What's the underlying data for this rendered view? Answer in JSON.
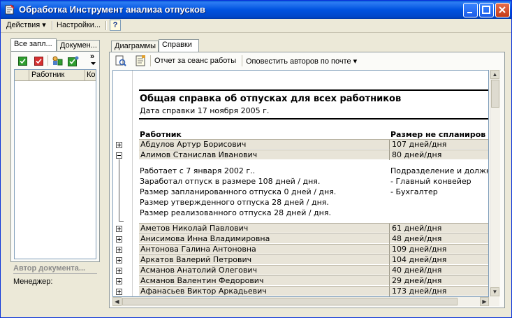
{
  "window": {
    "title": "Обработка  Инструмент анализа отпусков"
  },
  "menu": {
    "actions": "Действия ▾",
    "settings": "Настройки...",
    "help": "?"
  },
  "left": {
    "tabs": [
      "Все запл...",
      "Докумен..."
    ],
    "toolbar_more": "»",
    "list_header": {
      "col1": "Работник",
      "col2": "Ко"
    },
    "author_title": "Автор документа...",
    "manager_label": "Менеджер:"
  },
  "right": {
    "tabs": [
      "Диаграммы",
      "Справки"
    ],
    "toolbar": {
      "report_session": "Отчет за сеанс работы",
      "notify_authors": "Оповестить авторов по почте ▾"
    }
  },
  "report": {
    "title": "Общая справка об отпусках для всех работников",
    "date_line": "Дата справки 17 ноября 2005 г.",
    "col_employee": "Работник",
    "col_size": "Размер не спланиров",
    "rows_top": [
      {
        "name": "Абдулов Артур Борисович",
        "size": "107 дней/дня",
        "expanded": false
      },
      {
        "name": "Алимов Станислав Иванович",
        "size": "80 дней/дня",
        "expanded": true
      }
    ],
    "details_left": [
      "Работает с 7 января 2002 г..",
      "Заработал отпуск в размере 108 дней / дня.",
      "Размер запланированного отпуска 0 дней / дня.",
      "Размер утвержденного отпуска 28 дней / дня.",
      "Размер реализованного отпуска 28 дней / дня."
    ],
    "details_right": [
      "Подразделение и должн",
      "- Главный конвейер",
      "- Бухгалтер"
    ],
    "rows_bottom": [
      {
        "name": "Аметов Николай Павлович",
        "size": "61 дней/дня"
      },
      {
        "name": "Анисимова Инна Владимировна",
        "size": "48 дней/дня"
      },
      {
        "name": "Антонова Галина Антоновна",
        "size": "109 дней/дня"
      },
      {
        "name": "Аркатов Валерий Петрович",
        "size": "104 дней/дня"
      },
      {
        "name": "Асманов Анатолий Олегович",
        "size": "40 дней/дня"
      },
      {
        "name": "Асманов Валентин Федорович",
        "size": "29 дней/дня"
      },
      {
        "name": "Афанасьев Виктор Аркадьевич",
        "size": "173 дней/дня"
      }
    ]
  },
  "colors": {
    "titlebar": "#0053e0",
    "row_bg": "#e8e4d8",
    "window_bg": "#ece9d8"
  }
}
